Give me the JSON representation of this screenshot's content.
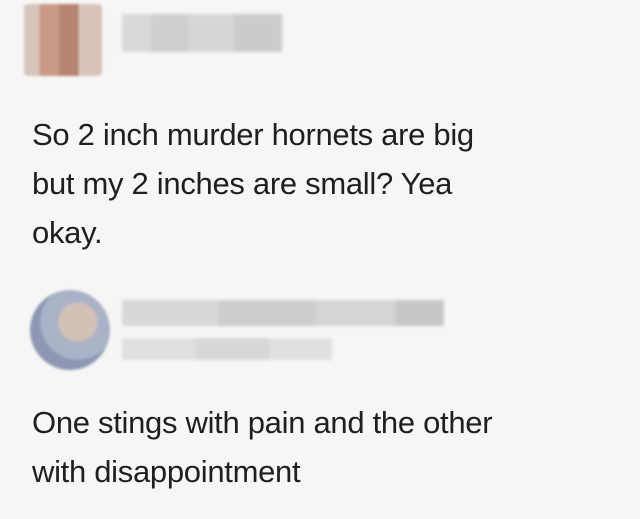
{
  "posts": [
    {
      "text": "So 2 inch murder hornets are big\nbut my 2 inches are small? Yea\nokay."
    },
    {
      "text": "One stings with pain and the other\nwith disappointment"
    }
  ]
}
